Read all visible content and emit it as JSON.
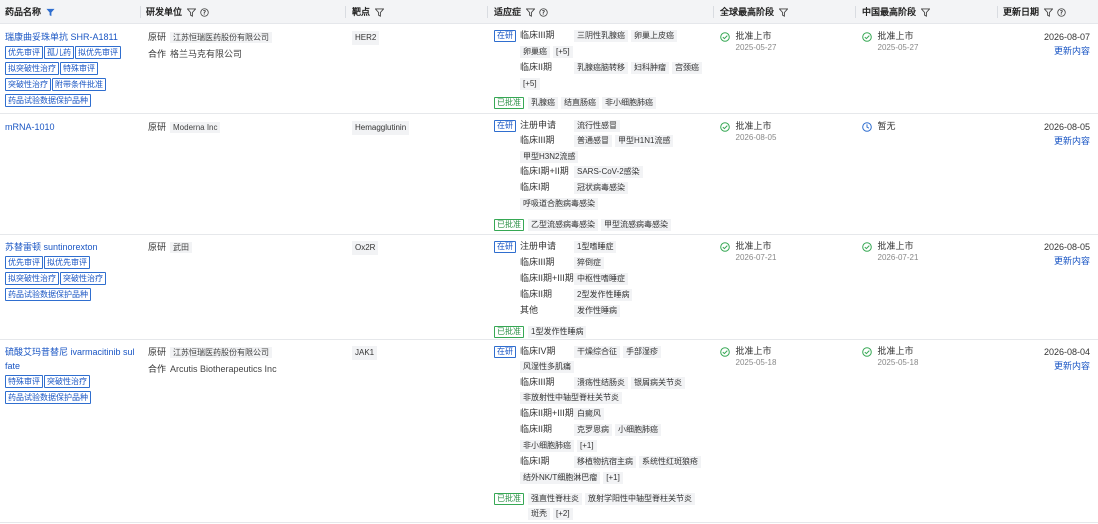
{
  "columns": {
    "drug": "药品名称",
    "org": "研发单位",
    "target": "靶点",
    "indication": "适应症",
    "global": "全球最高阶段",
    "china": "中国最高阶段",
    "updated": "更新日期"
  },
  "colors": {
    "link": "#1a56c4",
    "approved": "#36a854",
    "header_bg": "#f3f4f6"
  },
  "rows": [
    {
      "name": "瑞康曲妥珠单抗 SHR-A1811",
      "tags": [
        "优先审评",
        "孤儿药",
        "拟优先审评",
        "拟突破性治疗",
        "特殊审评",
        "突破性治疗",
        "附带条件批准",
        "药品试验数据保护品种"
      ],
      "org": [
        {
          "role": "原研",
          "name": "江苏恒瑞医药股份有限公司"
        },
        {
          "role": "合作",
          "name": "格兰马克有限公司"
        }
      ],
      "target": "HER2",
      "dev_label": "在研",
      "ind_lines": [
        {
          "phase": "临床III期",
          "items": [
            "三阴性乳腺癌",
            "卵巢上皮癌"
          ]
        },
        {
          "phase": "",
          "items": [
            "卵巢癌",
            "[+5]"
          ]
        },
        {
          "phase": "临床II期",
          "items": [
            "乳腺癌脑转移",
            "妇科肿瘤",
            "宫颈癌"
          ]
        },
        {
          "phase": "",
          "items": [
            "[+5]"
          ]
        }
      ],
      "app_label": "已批准",
      "approved": [
        "乳腺癌",
        "结直肠癌",
        "非小细胞肺癌"
      ],
      "global_stage": "批准上市",
      "global_date": "2025-05-27",
      "china_stage": "批准上市",
      "china_date": "2025-05-27",
      "updated": "2026-08-07",
      "link": "更新内容"
    },
    {
      "name": "mRNA-1010",
      "tags": [],
      "org": [
        {
          "role": "原研",
          "name": "Moderna Inc"
        }
      ],
      "target": "Hemagglutinin",
      "dev_label": "在研",
      "ind_lines": [
        {
          "phase": "注册申请",
          "items": [
            "流行性感冒"
          ]
        },
        {
          "phase": "临床III期",
          "items": [
            "普通感冒",
            "甲型H1N1流感"
          ]
        },
        {
          "phase": "",
          "items": [
            "甲型H3N2流感"
          ]
        },
        {
          "phase": "临床I期+II期",
          "items": [
            "SARS-CoV-2感染"
          ]
        },
        {
          "phase": "临床I期",
          "items": [
            "冠状病毒感染"
          ]
        },
        {
          "phase": "",
          "items": [
            "呼吸道合胞病毒感染"
          ]
        }
      ],
      "app_label": "已批准",
      "approved": [
        "乙型流感病毒感染",
        "甲型流感病毒感染"
      ],
      "global_stage": "批准上市",
      "global_date": "2026-08-05",
      "china_stage": "暂无",
      "china_date": "",
      "updated": "2026-08-05",
      "link": "更新内容"
    },
    {
      "name": "苏替雷顿 suntinorexton",
      "tags": [
        "优先审评",
        "拟优先审评",
        "拟突破性治疗",
        "突破性治疗",
        "药品试验数据保护品种"
      ],
      "org": [
        {
          "role": "原研",
          "name": "武田"
        }
      ],
      "target": "Ox2R",
      "dev_label": "在研",
      "ind_lines": [
        {
          "phase": "注册申请",
          "items": [
            "1型嗜睡症"
          ]
        },
        {
          "phase": "临床III期",
          "items": [
            "猝倒症"
          ]
        },
        {
          "phase": "临床II期+III期",
          "items": [
            "中枢性嗜睡症"
          ]
        },
        {
          "phase": "临床II期",
          "items": [
            "2型发作性睡病"
          ]
        },
        {
          "phase": "其他",
          "items": [
            "发作性睡病"
          ]
        }
      ],
      "app_label": "已批准",
      "approved": [
        "1型发作性睡病"
      ],
      "global_stage": "批准上市",
      "global_date": "2026-07-21",
      "china_stage": "批准上市",
      "china_date": "2026-07-21",
      "updated": "2026-08-05",
      "link": "更新内容"
    },
    {
      "name": "硫酸艾玛昔替尼 ivarmacitinib sulfate",
      "tags": [
        "特殊审评",
        "突破性治疗",
        "药品试验数据保护品种"
      ],
      "org": [
        {
          "role": "原研",
          "name": "江苏恒瑞医药股份有限公司"
        },
        {
          "role": "合作",
          "name": "Arcutis Biotherapeutics Inc"
        }
      ],
      "target": "JAK1",
      "dev_label": "在研",
      "ind_lines": [
        {
          "phase": "临床IV期",
          "items": [
            "干燥综合征",
            "手部湿疹"
          ]
        },
        {
          "phase": "",
          "items": [
            "风湿性多肌痛"
          ]
        },
        {
          "phase": "临床III期",
          "items": [
            "溃疡性结肠炎",
            "银屑病关节炎"
          ]
        },
        {
          "phase": "",
          "items": [
            "非放射性中轴型脊柱关节炎"
          ]
        },
        {
          "phase": "临床II期+III期",
          "items": [
            "白癜风"
          ]
        },
        {
          "phase": "临床II期",
          "items": [
            "克罗恩病",
            "小细胞肺癌"
          ]
        },
        {
          "phase": "",
          "items": [
            "非小细胞肺癌",
            "[+1]"
          ]
        },
        {
          "phase": "临床I期",
          "items": [
            "移植物抗宿主病",
            "系统性红斑狼疮"
          ]
        },
        {
          "phase": "",
          "items": [
            "结外NK/T细胞淋巴瘤",
            "[+1]"
          ]
        }
      ],
      "app_label": "已批准",
      "approved": [
        "强直性脊柱炎",
        "放射学阳性中轴型脊柱关节炎"
      ],
      "approved_more": [
        "斑秃",
        "[+2]"
      ],
      "global_stage": "批准上市",
      "global_date": "2025-05-18",
      "china_stage": "批准上市",
      "china_date": "2025-05-18",
      "updated": "2026-08-04",
      "link": "更新内容"
    }
  ]
}
